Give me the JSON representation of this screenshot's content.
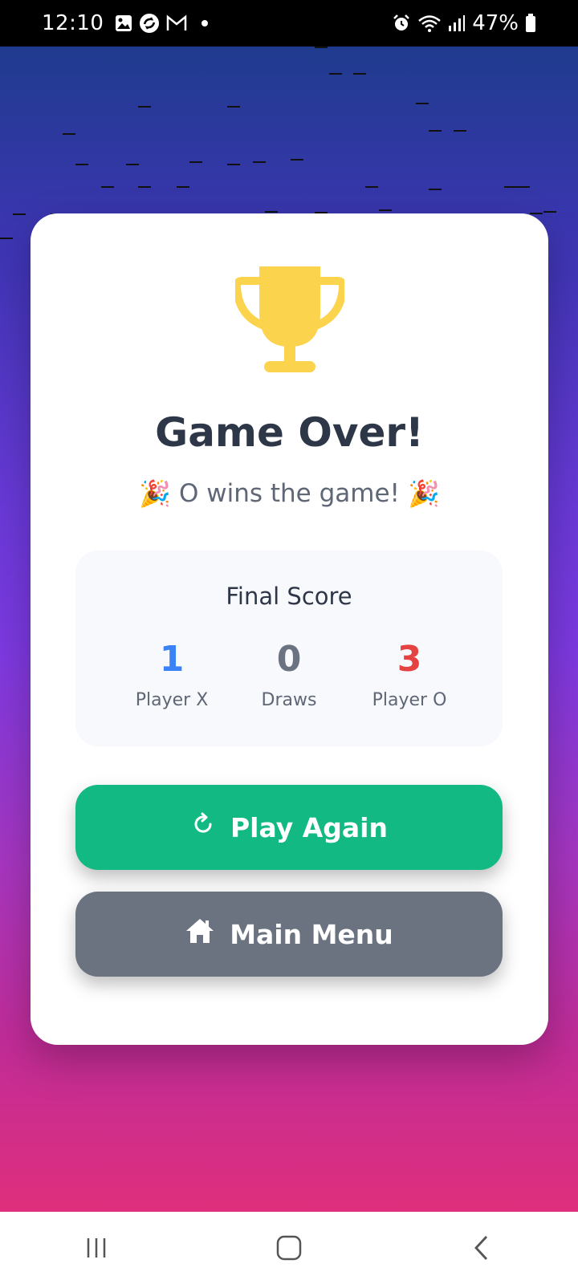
{
  "status_bar": {
    "time": "12:10",
    "battery": "47%",
    "left_icons": [
      "image-icon",
      "sync-app-icon",
      "gmail-icon",
      "notification-dot"
    ],
    "right_icons": [
      "alarm-icon",
      "wifi-icon",
      "signal-icon",
      "battery-icon"
    ]
  },
  "card": {
    "icon": "trophy-icon",
    "title": "Game Over!",
    "subtitle_emoji": "🎉",
    "subtitle_text": "O wins the game!",
    "score": {
      "title": "Final Score",
      "x_value": "1",
      "x_label": "Player X",
      "draws_value": "0",
      "draws_label": "Draws",
      "o_value": "3",
      "o_label": "Player O"
    },
    "play_again_label": "Play Again",
    "main_menu_label": "Main Menu"
  },
  "nav": {
    "items": [
      "recent-apps-icon",
      "home-icon",
      "back-icon"
    ]
  },
  "colors": {
    "accent_green": "#13b982",
    "gray_button": "#6b7280",
    "x_blue": "#3b82f6",
    "o_red": "#e54242",
    "trophy_gold": "#fcd34d"
  }
}
